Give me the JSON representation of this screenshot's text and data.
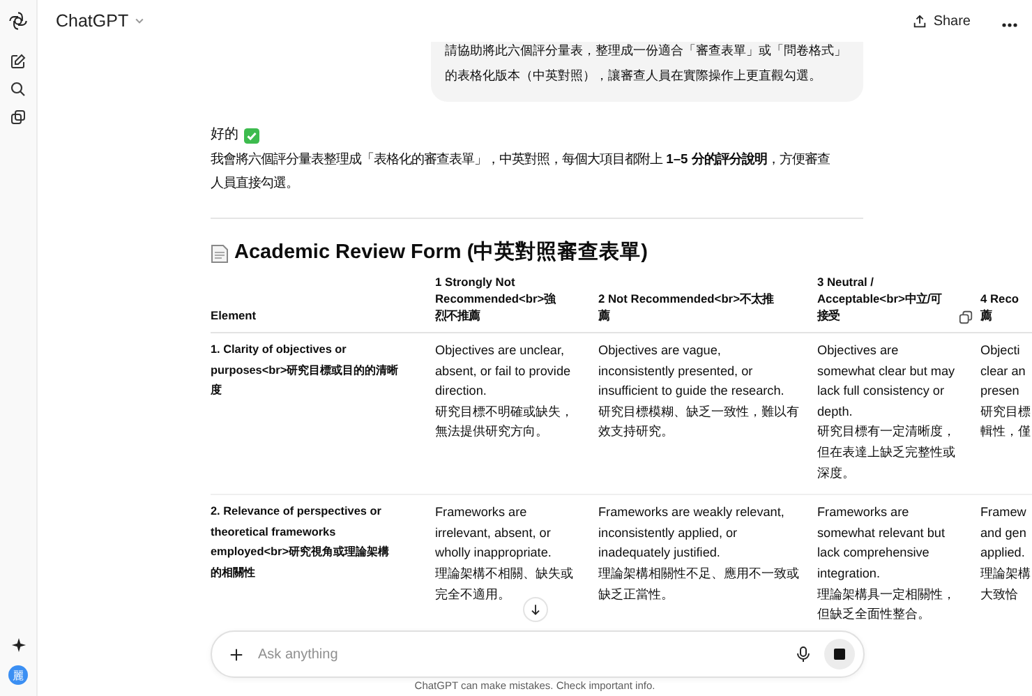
{
  "header": {
    "title": "ChatGPT",
    "share": "Share"
  },
  "sidebar": {
    "avatar": "麗"
  },
  "user_message": {
    "lines": [
      "請協助將此六個評分量表，整理成一份適合「審查表單」或「問卷格式」",
      "的表格化版本（中英對照），讓審查人員在實際操作上更直觀勾選。"
    ]
  },
  "reply": {
    "greeting": "好的",
    "lines": [
      "我會將六個評分量表整理成「表格化的審查表單」，中英對照，每個大項目都附上 **1–5 分的評分說明**，方便審查",
      "人員直接勾選。"
    ],
    "heading": "Academic Review Form (中英對照審查表單)",
    "table": {
      "columns": [
        {
          "lines": [
            "Element"
          ]
        },
        {
          "lines": [
            "1 Strongly Not",
            "Recommended<br>強",
            "烈不推薦"
          ]
        },
        {
          "lines": [
            "2 Not Recommended<br>不太推",
            "薦"
          ]
        },
        {
          "lines": [
            "3 Neutral /",
            "Acceptable<br>中立/可",
            "接受"
          ]
        },
        {
          "lines": [
            "4 Reco",
            "薦"
          ]
        }
      ],
      "rows": [
        {
          "cells": [
            {
              "lines": [
                "1. Clarity of objectives or",
                "purposes<br>研究目標或目的的清晰",
                "度"
              ]
            },
            {
              "lines": [
                "Objectives are unclear,",
                "absent, or fail to provide",
                "direction.",
                "研究目標不明確或缺失，",
                "無法提供研究方向。"
              ]
            },
            {
              "lines": [
                "Objectives are vague,",
                "inconsistently presented, or",
                "insufficient to guide the research.",
                "研究目標模糊、缺乏一致性，難以有",
                "效支持研究。"
              ]
            },
            {
              "lines": [
                "Objectives are",
                "somewhat clear but may",
                "lack full consistency or",
                "depth.",
                "研究目標有一定清晰度，",
                "但在表達上缺乏完整性或",
                "深度。"
              ]
            },
            {
              "lines": [
                "Objecti",
                "clear an",
                "presen",
                "研究目標",
                "輯性，僅"
              ]
            }
          ]
        },
        {
          "cells": [
            {
              "lines": [
                "2. Relevance of perspectives or",
                "theoretical frameworks",
                "employed<br>研究視角或理論架構",
                "的相關性"
              ]
            },
            {
              "lines": [
                "Frameworks are",
                "irrelevant, absent, or",
                "wholly inappropriate.",
                "理論架構不相關、缺失或",
                "完全不適用。"
              ]
            },
            {
              "lines": [
                "Frameworks are weakly relevant,",
                "inconsistently applied, or",
                "inadequately justified.",
                "理論架構相關性不足、應用不一致或",
                "缺乏正當性。"
              ]
            },
            {
              "lines": [
                "Frameworks are",
                "somewhat relevant but",
                "lack comprehensive",
                "integration.",
                "理論架構具一定相關性，",
                "但缺乏全面性整合。"
              ]
            },
            {
              "lines": [
                "Framew",
                "and gen",
                "applied.",
                "理論架構",
                "大致恰"
              ]
            }
          ]
        }
      ]
    }
  },
  "composer": {
    "placeholder": "Ask anything"
  },
  "footer": "ChatGPT can make mistakes. Check important info."
}
